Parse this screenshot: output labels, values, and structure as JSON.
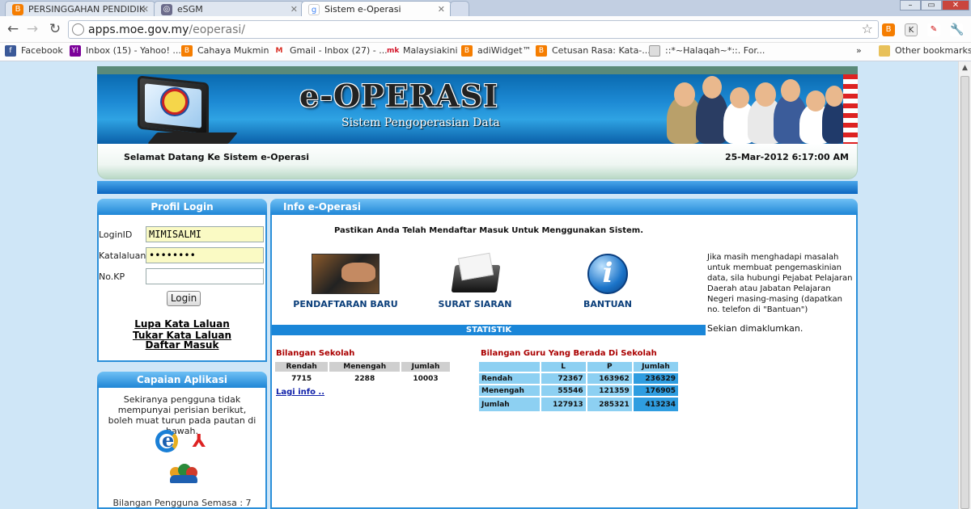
{
  "browser": {
    "tabs": [
      {
        "label": "PERSINGGAHAN PENDIDIK",
        "icon": "blogger-icon",
        "active": false
      },
      {
        "label": "eSGM",
        "icon": "globe-icon",
        "active": false
      },
      {
        "label": "Sistem e-Operasi",
        "icon": "google-icon",
        "active": true
      }
    ],
    "url": {
      "domain": "apps.moe.gov.my",
      "path": "/eoperasi/"
    },
    "bookmarks": [
      {
        "label": "Facebook",
        "icon": "facebook-icon",
        "color": "#3b5998"
      },
      {
        "label": "Inbox (15) - Yahoo! ...",
        "icon": "yahoo-icon",
        "color": "#7b0099"
      },
      {
        "label": "Cahaya Mukmin",
        "icon": "blogger-icon",
        "color": "#f57d00"
      },
      {
        "label": "Gmail - Inbox (27) - ...",
        "icon": "gmail-icon",
        "color": "#d93025"
      },
      {
        "label": "Malaysiakini",
        "icon": "malaysiakini-icon",
        "color": "#d2152a"
      },
      {
        "label": "adiWidget™",
        "icon": "blogger-icon",
        "color": "#f57d00"
      },
      {
        "label": "Cetusan Rasa: Kata-...",
        "icon": "blogger-icon",
        "color": "#f57d00"
      },
      {
        "label": "::*~Halaqah~*::. For...",
        "icon": "page-icon",
        "color": "#9c9c9c"
      }
    ],
    "overflow_label": "»",
    "other_bookmarks": "Other bookmarks"
  },
  "header": {
    "title": "e-OPERASI",
    "subtitle": "Sistem Pengoperasian Data",
    "welcome": "Selamat Datang Ke Sistem e-Operasi",
    "datetime": "25-Mar-2012 6:17:00 AM"
  },
  "login": {
    "title": "Profil Login",
    "loginid_label": "LoginID",
    "loginid_value": "MIMISALMI",
    "password_label": "Katalaluan",
    "password_value": "••••••••",
    "nokp_label": "No.KP",
    "nokp_value": "",
    "button": "Login",
    "links": [
      "Lupa Kata Laluan",
      "Tukar Kata Laluan",
      "Daftar Masuk"
    ]
  },
  "capaian": {
    "title": "Capaian Aplikasi",
    "text": "Sekiranya pengguna tidak mempunyai perisian berikut, boleh muat turun pada pautan di bawah.",
    "online_users": "Bilangan Pengguna Semasa : 7"
  },
  "info": {
    "title": "Info e-Operasi",
    "notice": "Pastikan Anda Telah Mendaftar Masuk Untuk Menggunakan Sistem.",
    "menu": [
      {
        "label": "PENDAFTARAN BARU"
      },
      {
        "label": "SURAT SIARAN"
      },
      {
        "label": "BANTUAN"
      }
    ],
    "side_note": "Jika masih menghadapi masalah untuk membuat pengemaskinian data, sila hubungi Pejabat Pelajaran Daerah atau Jabatan Pelajaran Negeri masing-masing (dapatkan no. telefon di \"Bantuan\")",
    "closing": "Sekian dimaklumkan."
  },
  "statistik": {
    "title": "STATISTIK",
    "sekolah_title": "Bilangan Sekolah",
    "sekolah_headers": [
      "Rendah",
      "Menengah",
      "Jumlah"
    ],
    "sekolah_values": [
      "7715",
      "2288",
      "10003"
    ],
    "lagi_info": "Lagi info ..",
    "guru_title": "Bilangan Guru Yang Berada Di Sekolah",
    "guru_headers": [
      "",
      "L",
      "P",
      "Jumlah"
    ],
    "guru_rows": [
      {
        "label": "Rendah",
        "l": "72367",
        "p": "163962",
        "jumlah": "236329"
      },
      {
        "label": "Menengah",
        "l": "55546",
        "p": "121359",
        "jumlah": "176905"
      },
      {
        "label": "Jumlah",
        "l": "127913",
        "p": "285321",
        "jumlah": "413234"
      }
    ]
  }
}
